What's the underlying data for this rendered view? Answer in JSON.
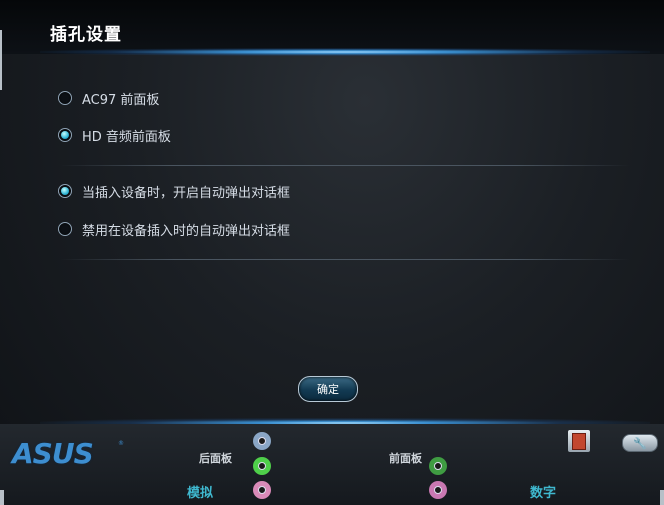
{
  "window": {
    "title": "插孔设置"
  },
  "front_panel_options": [
    {
      "label": "AC97 前面板",
      "checked": false
    },
    {
      "label": "HD 音频前面板",
      "checked": true
    }
  ],
  "popup_options": [
    {
      "label": "当插入设备时，开启自动弹出对话框",
      "checked": true
    },
    {
      "label": "禁用在设备插入时的自动弹出对话框",
      "checked": false
    }
  ],
  "buttons": {
    "ok_label": "确定"
  },
  "footer": {
    "logo": "ASUS",
    "logo_mark": "®",
    "rear_panel_label": "后面板",
    "front_panel_label": "前面板",
    "analog_label": "模拟",
    "digital_label": "数字",
    "jack_colors": {
      "blue": "#8aa6c6",
      "green": "#4fcf4a",
      "pink": "#d98ab8",
      "front_green": "#3f9c42",
      "front_pink": "#c978b2"
    }
  }
}
